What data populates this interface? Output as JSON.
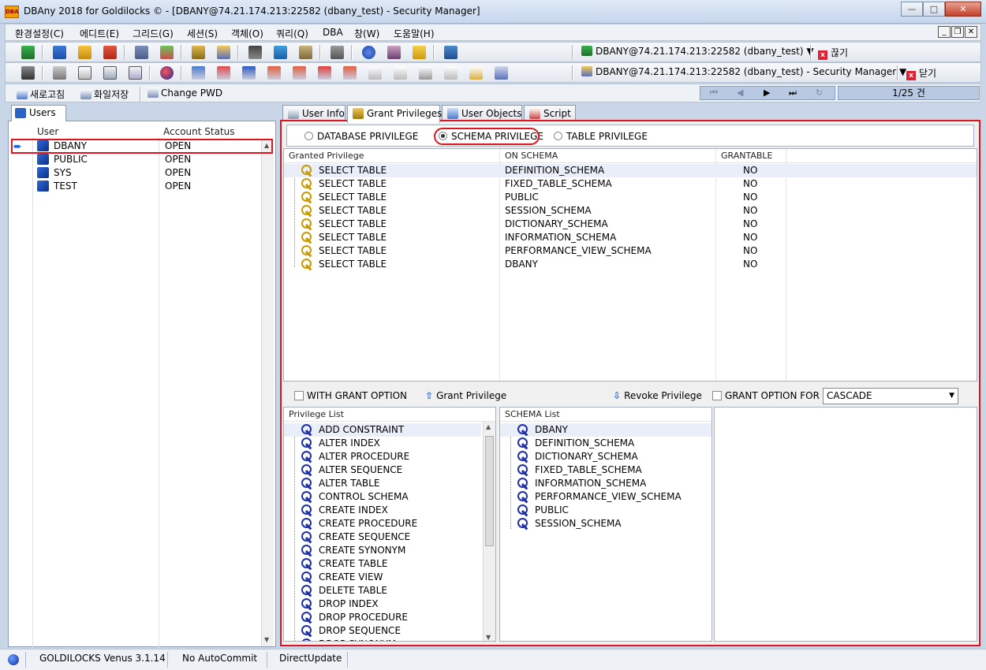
{
  "window": {
    "title": "DBAny 2018 for Goldilocks © - [DBANY@74.21.174.213:22582 (dbany_test) - Security Manager]",
    "app_icon_text": "DBA"
  },
  "menu": {
    "items": [
      "환경설정(C)",
      "에디트(E)",
      "그리드(G)",
      "세션(S)",
      "객체(O)",
      "쿼리(Q)",
      "DBA",
      "창(W)",
      "도움말(H)"
    ]
  },
  "toolbar1": {
    "connection": "DBANY@74.21.174.213:22582 (dbany_test) ▼",
    "disconnect_label": "끊기"
  },
  "toolbar2": {
    "connection": "DBANY@74.21.174.213:22582 (dbany_test) - Security Manager ▼",
    "close_label": "닫기"
  },
  "toolbar3": {
    "refresh_label": "새로고침",
    "save_file_label": "화일저장",
    "change_pwd_label": "Change PWD",
    "page_indicator": "1/25 건"
  },
  "left_panel": {
    "tab_label": "Users",
    "col_user": "User",
    "col_status": "Account Status",
    "users": [
      {
        "name": "DBANY",
        "status": "OPEN"
      },
      {
        "name": "PUBLIC",
        "status": "OPEN"
      },
      {
        "name": "SYS",
        "status": "OPEN"
      },
      {
        "name": "TEST",
        "status": "OPEN"
      }
    ]
  },
  "tabs": [
    "User Info",
    "Grant Privileges",
    "User Objects",
    "Script"
  ],
  "privilege_types": {
    "database": "DATABASE PRIVILEGE",
    "schema": "SCHEMA PRIVILEGE",
    "table": "TABLE PRIVILEGE",
    "selected": "schema"
  },
  "granted": {
    "col_privilege": "Granted Privilege",
    "col_schema": "ON SCHEMA",
    "col_grantable": "GRANTABLE",
    "rows": [
      {
        "privilege": "SELECT TABLE",
        "schema": "DEFINITION_SCHEMA",
        "grantable": "NO"
      },
      {
        "privilege": "SELECT TABLE",
        "schema": "FIXED_TABLE_SCHEMA",
        "grantable": "NO"
      },
      {
        "privilege": "SELECT TABLE",
        "schema": "PUBLIC",
        "grantable": "NO"
      },
      {
        "privilege": "SELECT TABLE",
        "schema": "SESSION_SCHEMA",
        "grantable": "NO"
      },
      {
        "privilege": "SELECT TABLE",
        "schema": "DICTIONARY_SCHEMA",
        "grantable": "NO"
      },
      {
        "privilege": "SELECT TABLE",
        "schema": "INFORMATION_SCHEMA",
        "grantable": "NO"
      },
      {
        "privilege": "SELECT TABLE",
        "schema": "PERFORMANCE_VIEW_SCHEMA",
        "grantable": "NO"
      },
      {
        "privilege": "SELECT TABLE",
        "schema": "DBANY",
        "grantable": "NO"
      }
    ]
  },
  "actions": {
    "with_grant_option": "WITH GRANT OPTION",
    "grant_privilege": "Grant Privilege",
    "revoke_privilege": "Revoke Privilege",
    "grant_option_for": "GRANT OPTION FOR",
    "cascade_value": "CASCADE"
  },
  "privilege_list": {
    "header": "Privilege List",
    "items": [
      "ADD CONSTRAINT",
      "ALTER INDEX",
      "ALTER PROCEDURE",
      "ALTER SEQUENCE",
      "ALTER TABLE",
      "CONTROL SCHEMA",
      "CREATE INDEX",
      "CREATE PROCEDURE",
      "CREATE SEQUENCE",
      "CREATE SYNONYM",
      "CREATE TABLE",
      "CREATE VIEW",
      "DELETE TABLE",
      "DROP INDEX",
      "DROP PROCEDURE",
      "DROP SEQUENCE",
      "DROP SYNONYM"
    ]
  },
  "schema_list": {
    "header": "SCHEMA List",
    "items": [
      "DBANY",
      "DEFINITION_SCHEMA",
      "DICTIONARY_SCHEMA",
      "FIXED_TABLE_SCHEMA",
      "INFORMATION_SCHEMA",
      "PERFORMANCE_VIEW_SCHEMA",
      "PUBLIC",
      "SESSION_SCHEMA"
    ]
  },
  "status": {
    "db_version": "GOLDILOCKS Venus 3.1.14",
    "commit_mode": "No AutoCommit",
    "update_mode": "DirectUpdate"
  },
  "colors": {
    "highlight_red": "#e0141e",
    "accent_blue": "#2b63c4",
    "key_gold": "#c89a00",
    "key_blue": "#1d2fa8"
  }
}
